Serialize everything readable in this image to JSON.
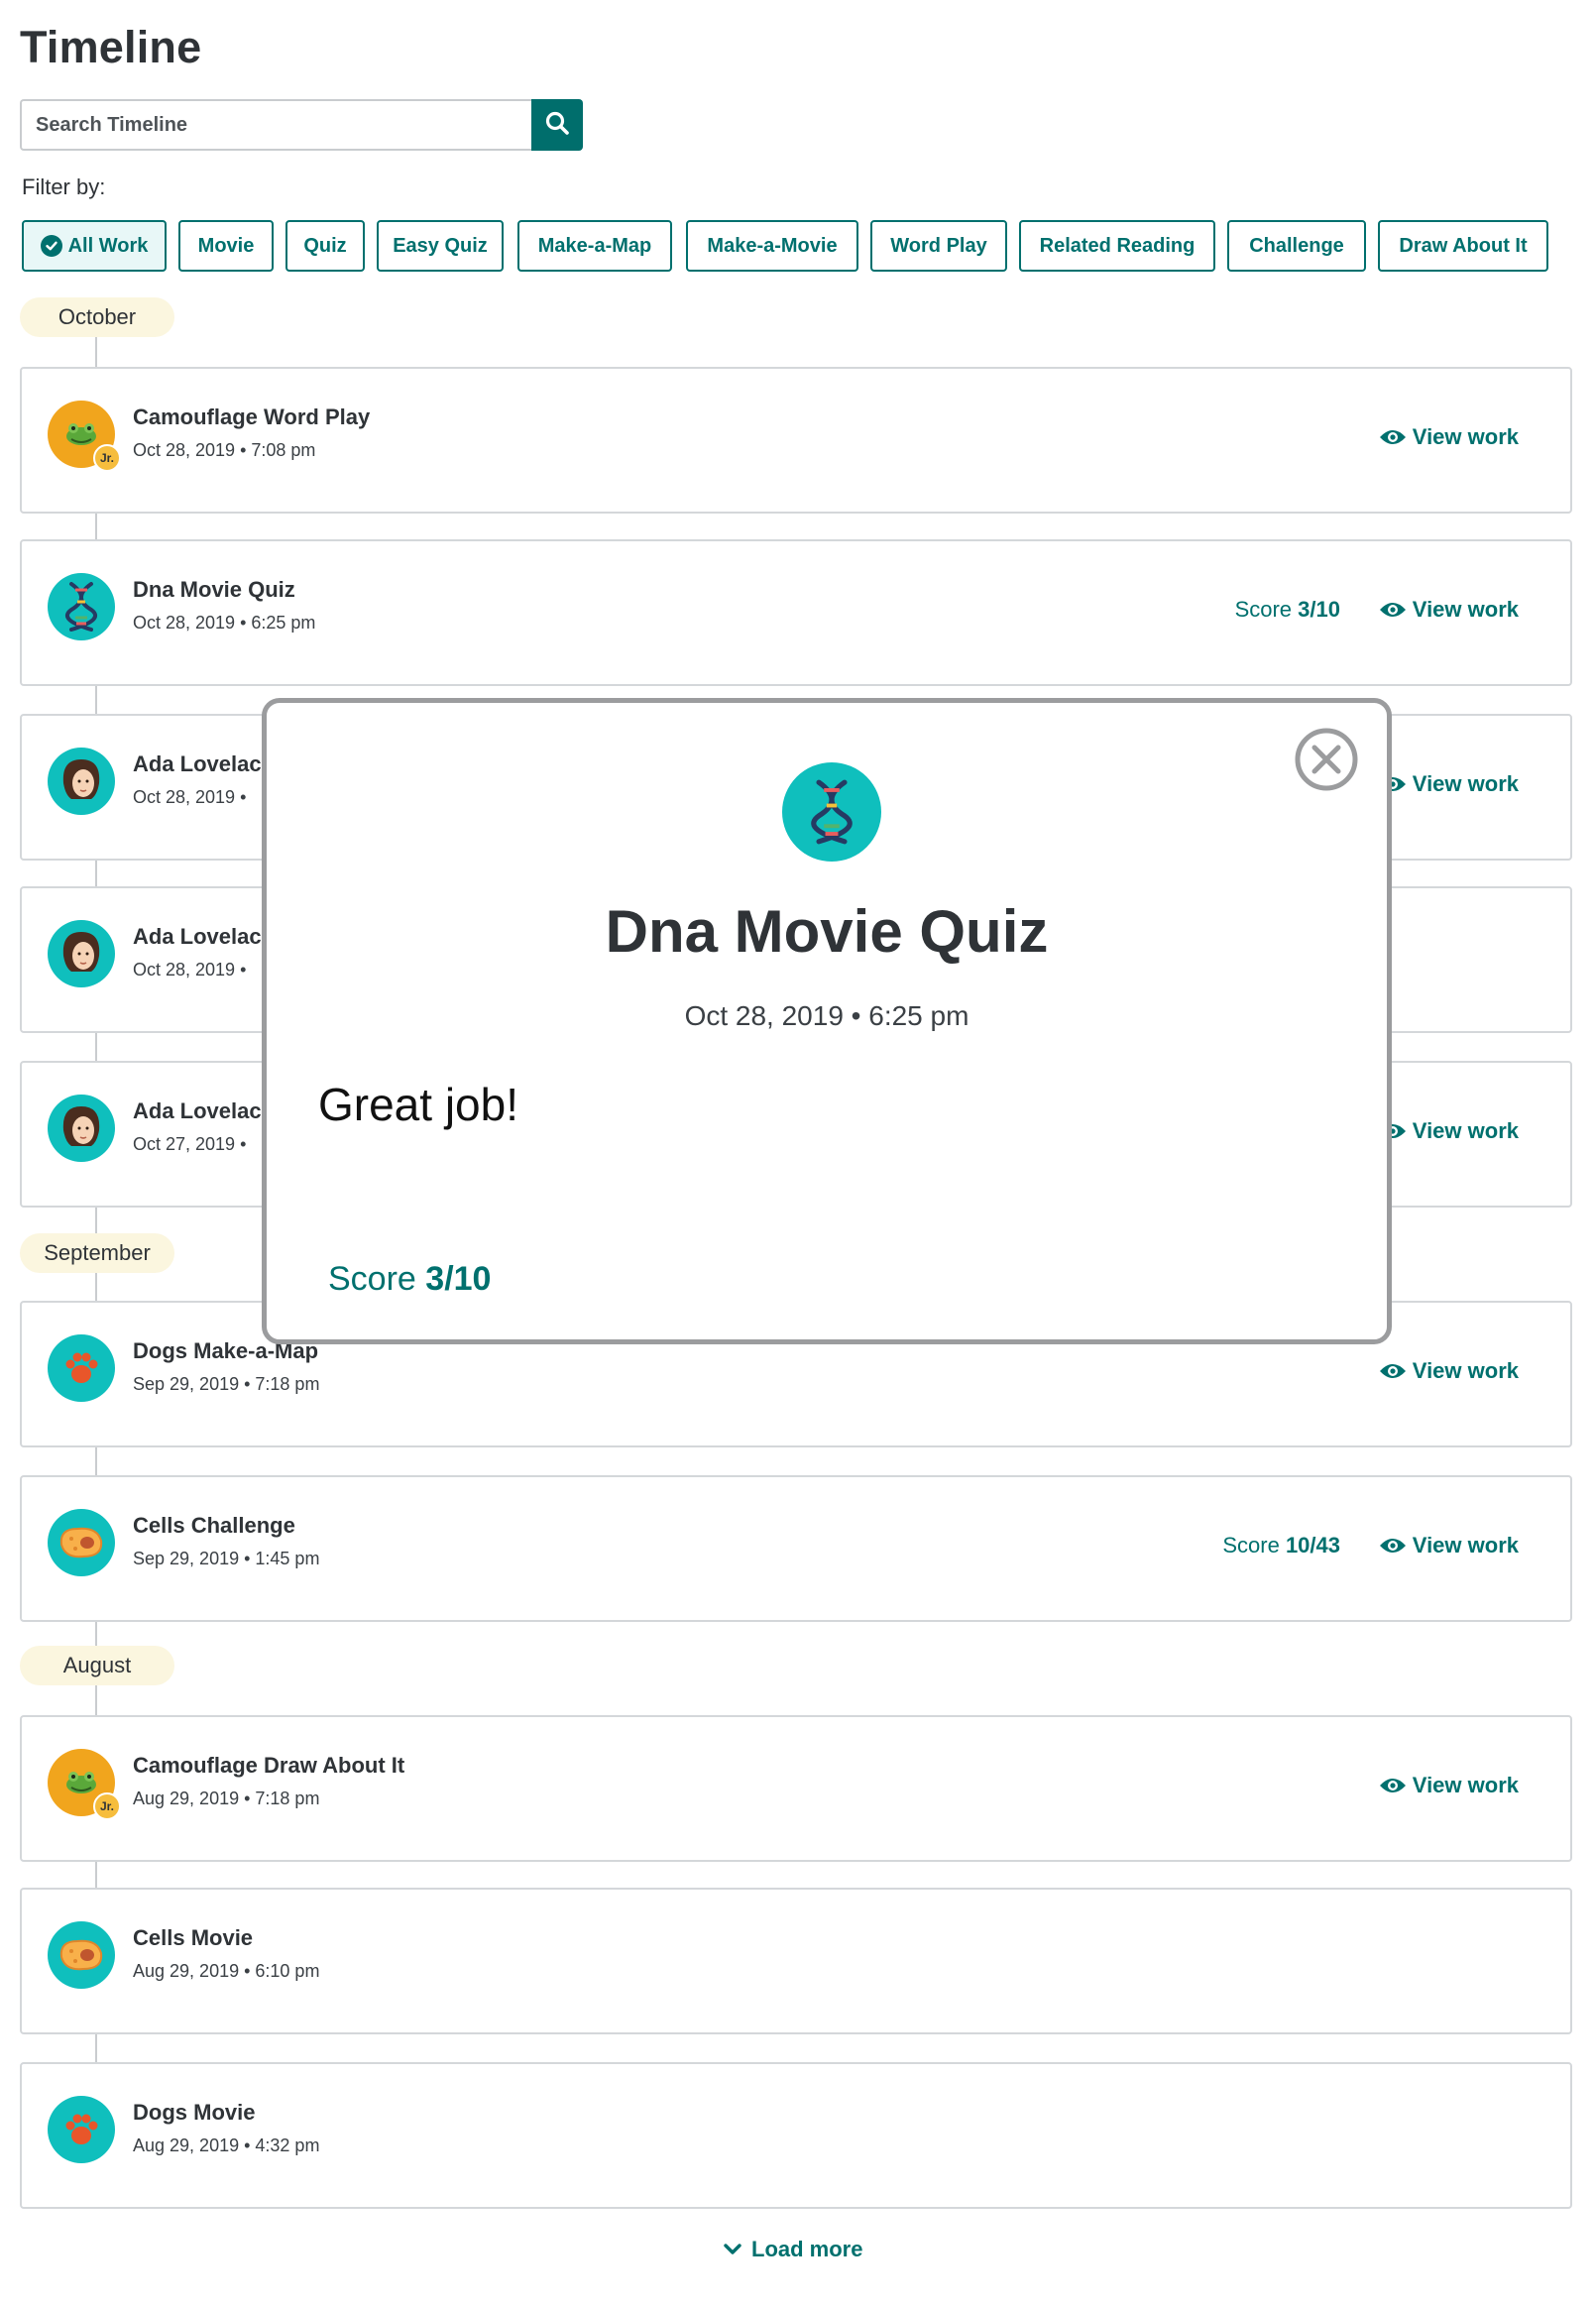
{
  "page_title": "Timeline",
  "search": {
    "placeholder": "Search Timeline"
  },
  "filter_label": "Filter by:",
  "filters": [
    {
      "label": "All Work",
      "active": true
    },
    {
      "label": "Movie"
    },
    {
      "label": "Quiz"
    },
    {
      "label": "Easy Quiz"
    },
    {
      "label": "Make-a-Map"
    },
    {
      "label": "Make-a-Movie"
    },
    {
      "label": "Word Play"
    },
    {
      "label": "Related Reading"
    },
    {
      "label": "Challenge"
    },
    {
      "label": "Draw About It"
    }
  ],
  "months": [
    "October",
    "September",
    "August"
  ],
  "view_label": "View work",
  "score_prefix": "Score",
  "items": [
    {
      "title": "Camouflage Word Play",
      "date": "Oct 28, 2019 • 7:08 pm",
      "icon": "frog-jr-icon",
      "score": "",
      "view": true
    },
    {
      "title": "Dna Movie Quiz",
      "date": "Oct 28, 2019 • 6:25 pm",
      "icon": "dna-icon",
      "score": "3/10",
      "view": true
    },
    {
      "title": "Ada Lovelac",
      "date": "Oct 28, 2019 •",
      "icon": "ada-lovelace-icon",
      "score": "",
      "view": true
    },
    {
      "title": "Ada Lovelac",
      "date": "Oct 28, 2019 •",
      "icon": "ada-lovelace-icon",
      "score": "",
      "view": false
    },
    {
      "title": "Ada Lovelac",
      "date": "Oct 27, 2019 •",
      "icon": "ada-lovelace-icon",
      "score": "",
      "view": true
    },
    {
      "title": "Dogs Make-a-Map",
      "date": "Sep 29, 2019 • 7:18 pm",
      "icon": "paw-icon",
      "score": "",
      "view": true
    },
    {
      "title": "Cells Challenge",
      "date": "Sep 29, 2019 • 1:45 pm",
      "icon": "cell-icon",
      "score": "10/43",
      "view": true
    },
    {
      "title": "Camouflage Draw About It",
      "date": "Aug 29, 2019 • 7:18 pm",
      "icon": "frog-jr-icon",
      "score": "",
      "view": true
    },
    {
      "title": "Cells Movie",
      "date": "Aug 29, 2019 • 6:10 pm",
      "icon": "cell-icon",
      "score": "",
      "view": false
    },
    {
      "title": "Dogs Movie",
      "date": "Aug 29, 2019 • 4:32 pm",
      "icon": "paw-icon",
      "score": "",
      "view": false
    }
  ],
  "jr_badge": "Jr.",
  "load_more": "Load more",
  "modal": {
    "title": "Dna Movie Quiz",
    "date": "Oct 28, 2019 • 6:25 pm",
    "message": "Great job!",
    "score_prefix": "Score",
    "score_value": "3/10"
  },
  "colors": {
    "accent": "#00706e",
    "avatar_teal": "#0fbfbd",
    "avatar_orange": "#f1a51d",
    "month_bg": "#fbf6df"
  }
}
